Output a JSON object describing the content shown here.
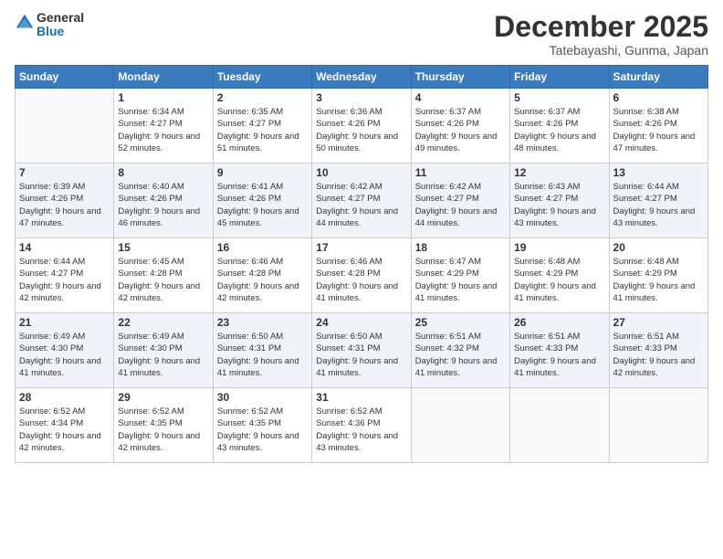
{
  "logo": {
    "text_general": "General",
    "text_blue": "Blue"
  },
  "header": {
    "month": "December 2025",
    "location": "Tatebayashi, Gunma, Japan"
  },
  "weekdays": [
    "Sunday",
    "Monday",
    "Tuesday",
    "Wednesday",
    "Thursday",
    "Friday",
    "Saturday"
  ],
  "weeks": [
    [
      {
        "day": "",
        "sunrise": "",
        "sunset": "",
        "daylight": ""
      },
      {
        "day": "1",
        "sunrise": "Sunrise: 6:34 AM",
        "sunset": "Sunset: 4:27 PM",
        "daylight": "Daylight: 9 hours and 52 minutes."
      },
      {
        "day": "2",
        "sunrise": "Sunrise: 6:35 AM",
        "sunset": "Sunset: 4:27 PM",
        "daylight": "Daylight: 9 hours and 51 minutes."
      },
      {
        "day": "3",
        "sunrise": "Sunrise: 6:36 AM",
        "sunset": "Sunset: 4:26 PM",
        "daylight": "Daylight: 9 hours and 50 minutes."
      },
      {
        "day": "4",
        "sunrise": "Sunrise: 6:37 AM",
        "sunset": "Sunset: 4:26 PM",
        "daylight": "Daylight: 9 hours and 49 minutes."
      },
      {
        "day": "5",
        "sunrise": "Sunrise: 6:37 AM",
        "sunset": "Sunset: 4:26 PM",
        "daylight": "Daylight: 9 hours and 48 minutes."
      },
      {
        "day": "6",
        "sunrise": "Sunrise: 6:38 AM",
        "sunset": "Sunset: 4:26 PM",
        "daylight": "Daylight: 9 hours and 47 minutes."
      }
    ],
    [
      {
        "day": "7",
        "sunrise": "Sunrise: 6:39 AM",
        "sunset": "Sunset: 4:26 PM",
        "daylight": "Daylight: 9 hours and 47 minutes."
      },
      {
        "day": "8",
        "sunrise": "Sunrise: 6:40 AM",
        "sunset": "Sunset: 4:26 PM",
        "daylight": "Daylight: 9 hours and 46 minutes."
      },
      {
        "day": "9",
        "sunrise": "Sunrise: 6:41 AM",
        "sunset": "Sunset: 4:26 PM",
        "daylight": "Daylight: 9 hours and 45 minutes."
      },
      {
        "day": "10",
        "sunrise": "Sunrise: 6:42 AM",
        "sunset": "Sunset: 4:27 PM",
        "daylight": "Daylight: 9 hours and 44 minutes."
      },
      {
        "day": "11",
        "sunrise": "Sunrise: 6:42 AM",
        "sunset": "Sunset: 4:27 PM",
        "daylight": "Daylight: 9 hours and 44 minutes."
      },
      {
        "day": "12",
        "sunrise": "Sunrise: 6:43 AM",
        "sunset": "Sunset: 4:27 PM",
        "daylight": "Daylight: 9 hours and 43 minutes."
      },
      {
        "day": "13",
        "sunrise": "Sunrise: 6:44 AM",
        "sunset": "Sunset: 4:27 PM",
        "daylight": "Daylight: 9 hours and 43 minutes."
      }
    ],
    [
      {
        "day": "14",
        "sunrise": "Sunrise: 6:44 AM",
        "sunset": "Sunset: 4:27 PM",
        "daylight": "Daylight: 9 hours and 42 minutes."
      },
      {
        "day": "15",
        "sunrise": "Sunrise: 6:45 AM",
        "sunset": "Sunset: 4:28 PM",
        "daylight": "Daylight: 9 hours and 42 minutes."
      },
      {
        "day": "16",
        "sunrise": "Sunrise: 6:46 AM",
        "sunset": "Sunset: 4:28 PM",
        "daylight": "Daylight: 9 hours and 42 minutes."
      },
      {
        "day": "17",
        "sunrise": "Sunrise: 6:46 AM",
        "sunset": "Sunset: 4:28 PM",
        "daylight": "Daylight: 9 hours and 41 minutes."
      },
      {
        "day": "18",
        "sunrise": "Sunrise: 6:47 AM",
        "sunset": "Sunset: 4:29 PM",
        "daylight": "Daylight: 9 hours and 41 minutes."
      },
      {
        "day": "19",
        "sunrise": "Sunrise: 6:48 AM",
        "sunset": "Sunset: 4:29 PM",
        "daylight": "Daylight: 9 hours and 41 minutes."
      },
      {
        "day": "20",
        "sunrise": "Sunrise: 6:48 AM",
        "sunset": "Sunset: 4:29 PM",
        "daylight": "Daylight: 9 hours and 41 minutes."
      }
    ],
    [
      {
        "day": "21",
        "sunrise": "Sunrise: 6:49 AM",
        "sunset": "Sunset: 4:30 PM",
        "daylight": "Daylight: 9 hours and 41 minutes."
      },
      {
        "day": "22",
        "sunrise": "Sunrise: 6:49 AM",
        "sunset": "Sunset: 4:30 PM",
        "daylight": "Daylight: 9 hours and 41 minutes."
      },
      {
        "day": "23",
        "sunrise": "Sunrise: 6:50 AM",
        "sunset": "Sunset: 4:31 PM",
        "daylight": "Daylight: 9 hours and 41 minutes."
      },
      {
        "day": "24",
        "sunrise": "Sunrise: 6:50 AM",
        "sunset": "Sunset: 4:31 PM",
        "daylight": "Daylight: 9 hours and 41 minutes."
      },
      {
        "day": "25",
        "sunrise": "Sunrise: 6:51 AM",
        "sunset": "Sunset: 4:32 PM",
        "daylight": "Daylight: 9 hours and 41 minutes."
      },
      {
        "day": "26",
        "sunrise": "Sunrise: 6:51 AM",
        "sunset": "Sunset: 4:33 PM",
        "daylight": "Daylight: 9 hours and 41 minutes."
      },
      {
        "day": "27",
        "sunrise": "Sunrise: 6:51 AM",
        "sunset": "Sunset: 4:33 PM",
        "daylight": "Daylight: 9 hours and 42 minutes."
      }
    ],
    [
      {
        "day": "28",
        "sunrise": "Sunrise: 6:52 AM",
        "sunset": "Sunset: 4:34 PM",
        "daylight": "Daylight: 9 hours and 42 minutes."
      },
      {
        "day": "29",
        "sunrise": "Sunrise: 6:52 AM",
        "sunset": "Sunset: 4:35 PM",
        "daylight": "Daylight: 9 hours and 42 minutes."
      },
      {
        "day": "30",
        "sunrise": "Sunrise: 6:52 AM",
        "sunset": "Sunset: 4:35 PM",
        "daylight": "Daylight: 9 hours and 43 minutes."
      },
      {
        "day": "31",
        "sunrise": "Sunrise: 6:52 AM",
        "sunset": "Sunset: 4:36 PM",
        "daylight": "Daylight: 9 hours and 43 minutes."
      },
      {
        "day": "",
        "sunrise": "",
        "sunset": "",
        "daylight": ""
      },
      {
        "day": "",
        "sunrise": "",
        "sunset": "",
        "daylight": ""
      },
      {
        "day": "",
        "sunrise": "",
        "sunset": "",
        "daylight": ""
      }
    ]
  ]
}
